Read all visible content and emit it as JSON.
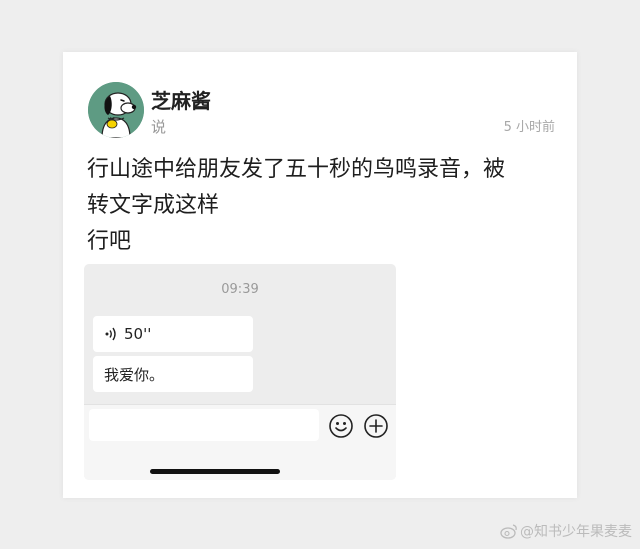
{
  "post": {
    "username": "芝麻酱",
    "subtitle": "说",
    "timestamp": "5 小时前",
    "text_lines": [
      "行山途中给朋友发了五十秒的鸟鸣录音，被",
      "转文字成这样",
      "行吧"
    ]
  },
  "chat": {
    "time": "09:39",
    "voice_duration": "50''",
    "transcription": "我爱你。"
  },
  "icons": {
    "avatar": "snoopy-avatar-icon",
    "voice": "voice-wave-icon",
    "emoji": "smiley-face-icon",
    "plus": "plus-circle-icon",
    "watermark": "weibo-icon"
  },
  "watermark": {
    "text": "@知书少年果麦麦"
  },
  "colors": {
    "avatar_bg": "#5e9b83",
    "chat_bg": "#ededed",
    "bubble_bg": "#ffffff"
  }
}
